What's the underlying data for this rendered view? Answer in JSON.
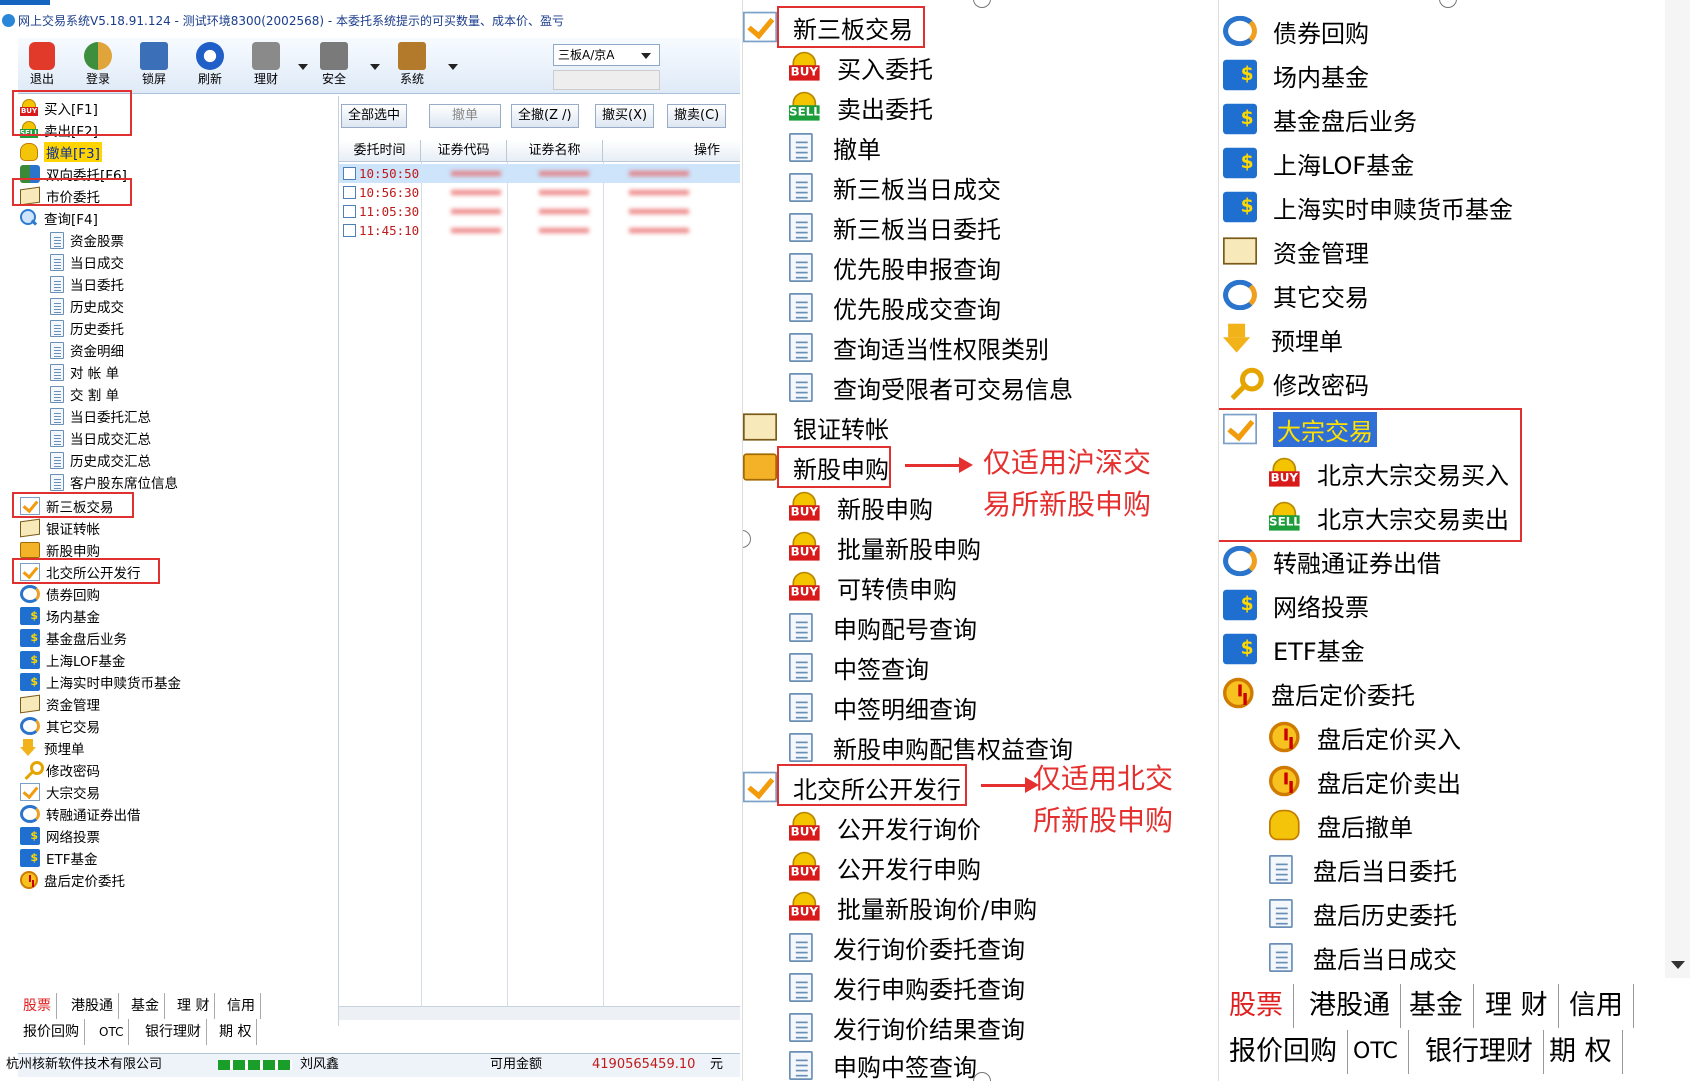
{
  "window": {
    "title": "网上交易系统V5.18.91.124 - 测试环境8300(2002568) - 本委托系统提示的可买数量、成本价、盈亏"
  },
  "toolbar": {
    "buttons": [
      "退出",
      "登录",
      "锁屏",
      "刷新",
      "理财",
      "安全",
      "系统"
    ],
    "market_select": "三板A/京A"
  },
  "tree": {
    "items": [
      {
        "label": "买入[F1]",
        "icon": "buy-icon"
      },
      {
        "label": "卖出[F2]",
        "icon": "sell-icon"
      },
      {
        "label": "撤单[F3]",
        "icon": "hand-icon"
      },
      {
        "label": "双向委托[F6]",
        "icon": "dual-icon"
      },
      {
        "label": "市价委托",
        "icon": "card-icon"
      },
      {
        "label": "查询[F4]",
        "icon": "magnifier-icon"
      },
      {
        "label": "资金股票",
        "icon": "document-icon"
      },
      {
        "label": "当日成交",
        "icon": "document-icon"
      },
      {
        "label": "当日委托",
        "icon": "document-icon"
      },
      {
        "label": "历史成交",
        "icon": "document-icon"
      },
      {
        "label": "历史委托",
        "icon": "document-icon"
      },
      {
        "label": "资金明细",
        "icon": "document-icon"
      },
      {
        "label": "对 帐 单",
        "icon": "document-icon"
      },
      {
        "label": "交 割 单",
        "icon": "document-icon"
      },
      {
        "label": "当日委托汇总",
        "icon": "document-icon"
      },
      {
        "label": "当日成交汇总",
        "icon": "document-icon"
      },
      {
        "label": "历史成交汇总",
        "icon": "document-icon"
      },
      {
        "label": "客户股东席位信息",
        "icon": "document-icon"
      },
      {
        "label": "新三板交易",
        "icon": "check-icon"
      },
      {
        "label": "银证转帐",
        "icon": "card-icon"
      },
      {
        "label": "新股申购",
        "icon": "folder-icon"
      },
      {
        "label": "北交所公开发行",
        "icon": "check-icon"
      },
      {
        "label": "债券回购",
        "icon": "swap-icon"
      },
      {
        "label": "场内基金",
        "icon": "fund-icon"
      },
      {
        "label": "基金盘后业务",
        "icon": "fund-icon"
      },
      {
        "label": "上海LOF基金",
        "icon": "fund-icon"
      },
      {
        "label": "上海实时申赎货币基金",
        "icon": "fund-icon"
      },
      {
        "label": "资金管理",
        "icon": "card-icon"
      },
      {
        "label": "其它交易",
        "icon": "swap-icon"
      },
      {
        "label": "预埋单",
        "icon": "arrow-down-icon"
      },
      {
        "label": "修改密码",
        "icon": "key-icon"
      },
      {
        "label": "大宗交易",
        "icon": "check-icon"
      },
      {
        "label": "转融通证券出借",
        "icon": "swap-icon"
      },
      {
        "label": "网络投票",
        "icon": "fund-icon"
      },
      {
        "label": "ETF基金",
        "icon": "fund-icon"
      },
      {
        "label": "盘后定价委托",
        "icon": "clock-icon"
      }
    ]
  },
  "tabs": {
    "row1": [
      "股票",
      "港股通",
      "基金",
      "理 财",
      "信用"
    ],
    "row2": [
      "报价回购",
      "OTC",
      "银行理财",
      "期 权"
    ]
  },
  "actions": [
    "全部选中",
    "撤单",
    "全撤(Z /)",
    "撤买(X)",
    "撤卖(C)"
  ],
  "grid": {
    "headers": [
      "委托时间",
      "证券代码",
      "证券名称",
      "操作"
    ],
    "rows": [
      "10:50:50",
      "10:56:30",
      "11:05:30",
      "11:45:10"
    ]
  },
  "status": {
    "company": "杭州核新软件技术有限公司",
    "user": "刘风鑫",
    "available_label": "可用金额",
    "available_value": "4190565459.10",
    "unit": "元"
  },
  "zoom_middle": {
    "items": [
      {
        "label": "新三板交易",
        "icon": "check-icon"
      },
      {
        "label": "买入委托",
        "icon": "buy-icon"
      },
      {
        "label": "卖出委托",
        "icon": "sell-icon"
      },
      {
        "label": "撤单",
        "icon": "document-icon"
      },
      {
        "label": "新三板当日成交",
        "icon": "document-icon"
      },
      {
        "label": "新三板当日委托",
        "icon": "document-icon"
      },
      {
        "label": "优先股申报查询",
        "icon": "document-icon"
      },
      {
        "label": "优先股成交查询",
        "icon": "document-icon"
      },
      {
        "label": "查询适当性权限类别",
        "icon": "document-icon"
      },
      {
        "label": "查询受限者可交易信息",
        "icon": "document-icon"
      },
      {
        "label": "银证转帐",
        "icon": "card-icon"
      },
      {
        "label": "新股申购",
        "icon": "folder-icon"
      },
      {
        "label": "新股申购",
        "icon": "buy-icon"
      },
      {
        "label": "批量新股申购",
        "icon": "buy-icon"
      },
      {
        "label": "可转债申购",
        "icon": "buy-icon"
      },
      {
        "label": "申购配号查询",
        "icon": "document-icon"
      },
      {
        "label": "中签查询",
        "icon": "document-icon"
      },
      {
        "label": "中签明细查询",
        "icon": "document-icon"
      },
      {
        "label": "新股申购配售权益查询",
        "icon": "document-icon"
      },
      {
        "label": "北交所公开发行",
        "icon": "check-icon"
      },
      {
        "label": "公开发行询价",
        "icon": "buy-icon"
      },
      {
        "label": "公开发行申购",
        "icon": "buy-icon"
      },
      {
        "label": "批量新股询价/申购",
        "icon": "buy-icon"
      },
      {
        "label": "发行询价委托查询",
        "icon": "document-icon"
      },
      {
        "label": "发行申购委托查询",
        "icon": "document-icon"
      },
      {
        "label": "发行询价结果查询",
        "icon": "document-icon"
      },
      {
        "label": "申购中签查询",
        "icon": "document-icon"
      }
    ],
    "annotation1": [
      "仅适用沪深交",
      "易所新股申购"
    ],
    "annotation2": [
      "仅适用北交",
      "所新股申购"
    ]
  },
  "zoom_right": {
    "items": [
      {
        "label": "债券回购",
        "icon": "swap-icon"
      },
      {
        "label": "场内基金",
        "icon": "fund-icon"
      },
      {
        "label": "基金盘后业务",
        "icon": "fund-icon"
      },
      {
        "label": "上海LOF基金",
        "icon": "fund-icon"
      },
      {
        "label": "上海实时申赎货币基金",
        "icon": "fund-icon"
      },
      {
        "label": "资金管理",
        "icon": "card-icon"
      },
      {
        "label": "其它交易",
        "icon": "swap-icon"
      },
      {
        "label": "预埋单",
        "icon": "arrow-down-icon"
      },
      {
        "label": "修改密码",
        "icon": "key-icon"
      },
      {
        "label": "大宗交易",
        "icon": "check-icon"
      },
      {
        "label": "北京大宗交易买入",
        "icon": "buy-icon"
      },
      {
        "label": "北京大宗交易卖出",
        "icon": "sell-icon"
      },
      {
        "label": "转融通证券出借",
        "icon": "swap-icon"
      },
      {
        "label": "网络投票",
        "icon": "fund-icon"
      },
      {
        "label": "ETF基金",
        "icon": "fund-icon"
      },
      {
        "label": "盘后定价委托",
        "icon": "clock-icon"
      },
      {
        "label": "盘后定价买入",
        "icon": "clock-icon"
      },
      {
        "label": "盘后定价卖出",
        "icon": "clock-icon"
      },
      {
        "label": "盘后撤单",
        "icon": "hand-icon"
      },
      {
        "label": "盘后当日委托",
        "icon": "document-icon"
      },
      {
        "label": "盘后历史委托",
        "icon": "document-icon"
      },
      {
        "label": "盘后当日成交",
        "icon": "document-icon"
      }
    ]
  },
  "colors": {
    "highlight_box": "#e03030",
    "annotation_text": "#e53030",
    "selection_yellow": "#ffd400",
    "selection_blue": "#2f6fd6"
  }
}
